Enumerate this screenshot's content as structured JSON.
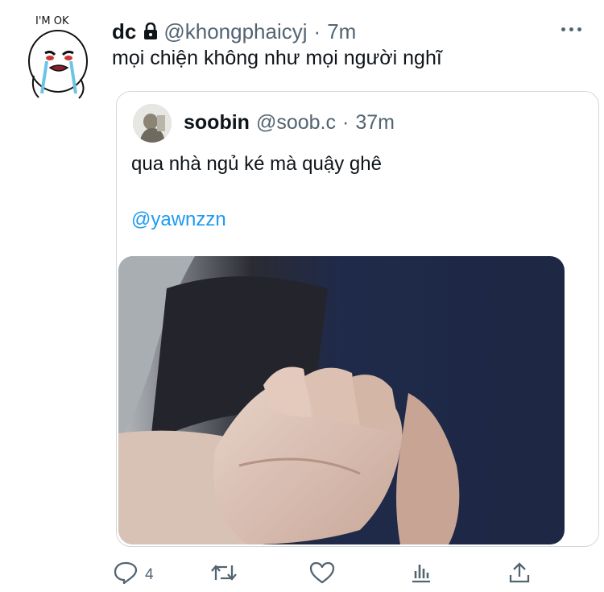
{
  "tweet": {
    "author_name": "dc",
    "handle": "@khongphaicyj",
    "separator": "·",
    "time": "7m",
    "text": "mọi chiện không như mọi người nghĩ",
    "avatar_caption": "I'M OK",
    "icons": {
      "lock": "lock-icon",
      "more": "more-icon"
    }
  },
  "quoted": {
    "author_name": "soobin",
    "handle": "@soob.c",
    "separator": "·",
    "time": "37m",
    "text": "qua nhà ngủ ké mà quậy ghê",
    "mention": "@yawnzzn"
  },
  "actions": {
    "reply_count": "4",
    "icons": [
      "reply-icon",
      "retweet-icon",
      "like-icon",
      "analytics-icon",
      "share-icon"
    ]
  },
  "colors": {
    "link": "#1d9bf0",
    "secondary": "#536471",
    "border": "#cfd9de"
  }
}
